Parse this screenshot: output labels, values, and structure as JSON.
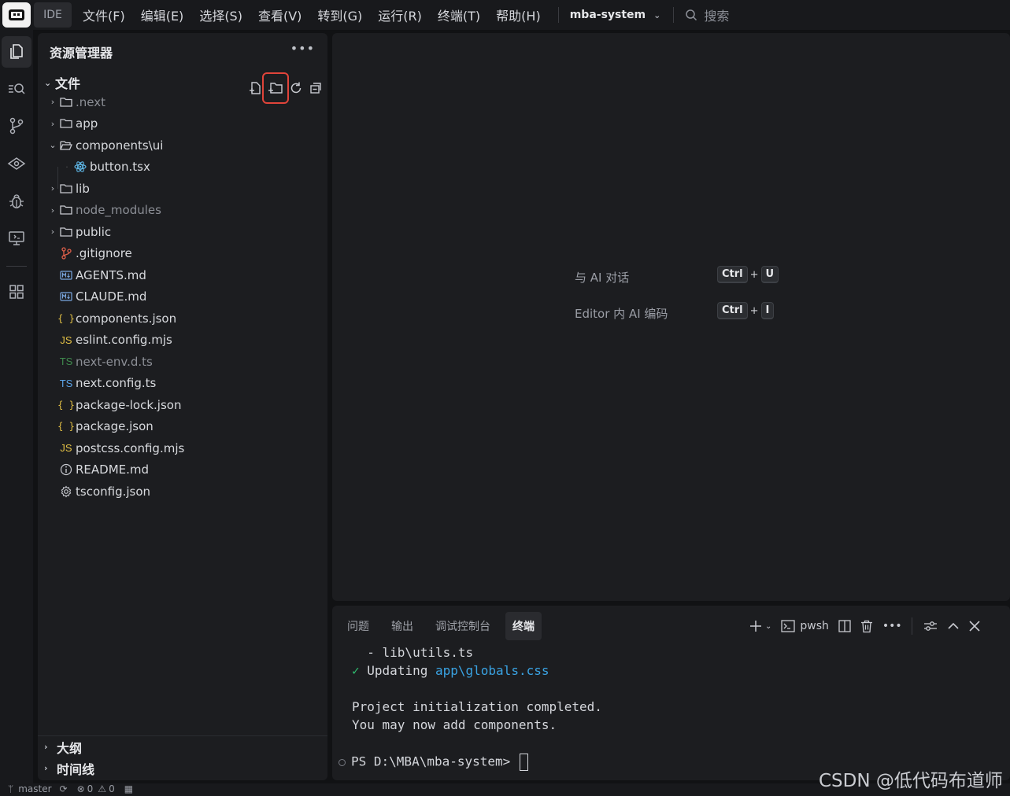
{
  "titlebar": {
    "ide_label": "IDE",
    "menu": [
      "文件(F)",
      "编辑(E)",
      "选择(S)",
      "查看(V)",
      "转到(G)",
      "运行(R)",
      "终端(T)",
      "帮助(H)"
    ],
    "project": "mba-system",
    "search_label": "搜索"
  },
  "sidebar": {
    "title": "资源管理器",
    "files_section": "文件",
    "outline_section": "大纲",
    "timeline_section": "时间线",
    "tree": [
      {
        "name": ".next",
        "type": "folder",
        "open": false,
        "dim": true
      },
      {
        "name": "app",
        "type": "folder",
        "open": false
      },
      {
        "name": "components\\ui",
        "type": "folder",
        "open": true
      },
      {
        "name": "button.tsx",
        "type": "react",
        "child": true
      },
      {
        "name": "lib",
        "type": "folder",
        "open": false
      },
      {
        "name": "node_modules",
        "type": "folder",
        "open": false,
        "dim": true
      },
      {
        "name": "public",
        "type": "folder",
        "open": false
      },
      {
        "name": ".gitignore",
        "type": "git"
      },
      {
        "name": "AGENTS.md",
        "type": "md"
      },
      {
        "name": "CLAUDE.md",
        "type": "md"
      },
      {
        "name": "components.json",
        "type": "json"
      },
      {
        "name": "eslint.config.mjs",
        "type": "js"
      },
      {
        "name": "next-env.d.ts",
        "type": "ts",
        "dim": true
      },
      {
        "name": "next.config.ts",
        "type": "ts"
      },
      {
        "name": "package-lock.json",
        "type": "json"
      },
      {
        "name": "package.json",
        "type": "json"
      },
      {
        "name": "postcss.config.mjs",
        "type": "js"
      },
      {
        "name": "README.md",
        "type": "info"
      },
      {
        "name": "tsconfig.json",
        "type": "gear"
      }
    ]
  },
  "editor": {
    "hints": [
      {
        "label": "与 AI 对话",
        "keys": [
          "Ctrl",
          "U"
        ]
      },
      {
        "label": "Editor 内 AI 编码",
        "keys": [
          "Ctrl",
          "I"
        ]
      }
    ]
  },
  "panel": {
    "tabs": [
      "问题",
      "输出",
      "调试控制台",
      "终端"
    ],
    "active_tab": 3,
    "shell": "pwsh",
    "terminal": {
      "line1": "  - lib\\utils.ts",
      "check": "✓",
      "updating": "Updating ",
      "updating_path": "app\\globals.css",
      "line3": "Project initialization completed.",
      "line4": "You may now add components.",
      "prompt": "PS D:\\MBA\\mba-system> "
    }
  },
  "statusbar": {
    "branch": "master",
    "errors": "0",
    "warnings": "0"
  },
  "watermark": "CSDN @低代码布道师",
  "colors": {
    "highlight_box": "#e0443a",
    "terminal_green": "#2fbf71",
    "terminal_blue": "#3aa3e3"
  }
}
